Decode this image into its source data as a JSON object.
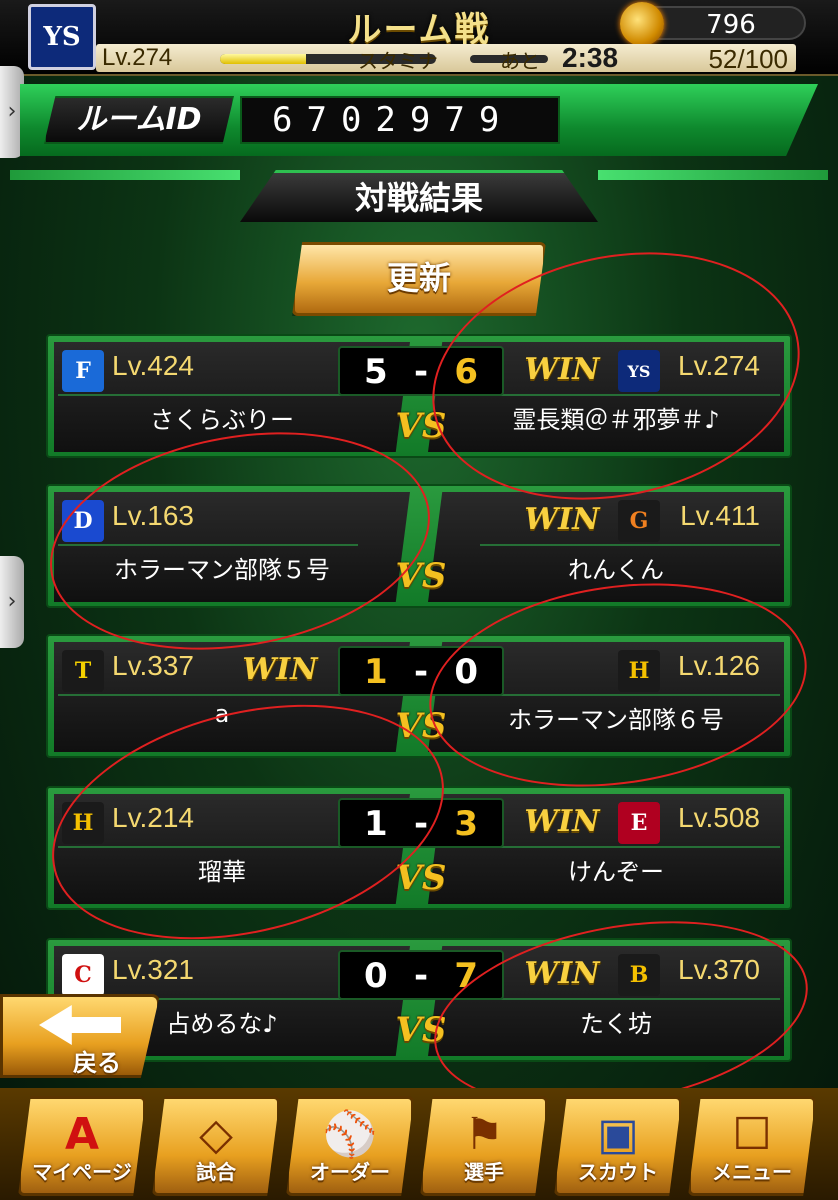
{
  "header": {
    "title": "ルーム戦",
    "team_logo": "YS",
    "coins": "796",
    "level": "Lv.274",
    "stamina_label": "スタミナ",
    "ato_label": "あと",
    "timer": "2:38",
    "stamina": "52/100"
  },
  "room": {
    "label": "ルームID",
    "id": "6702979"
  },
  "section_title": "対戦結果",
  "refresh_label": "更新",
  "matches": [
    {
      "left": {
        "logo": "F",
        "logo_color": "#1a6ad8",
        "level": "Lv.424",
        "name": "さくらぶりー"
      },
      "right": {
        "logo": "YS",
        "logo_color": "#0d2a7a",
        "level": "Lv.274",
        "name": "霊長類＠＃邪夢＃♪"
      },
      "score_left": "5",
      "score_dash": "-",
      "score_right": "6",
      "winner": "right"
    },
    {
      "left": {
        "logo": "D",
        "logo_color": "#1a4ad0",
        "level": "Lv.163",
        "name": "ホラーマン部隊５号"
      },
      "right": {
        "logo": "G",
        "logo_color": "#1a1a1a",
        "level": "Lv.411",
        "name": "れんくん"
      },
      "score_left": "",
      "score_dash": "",
      "score_right": "",
      "winner": "right"
    },
    {
      "left": {
        "logo": "T",
        "logo_color": "#1a1a1a",
        "level": "Lv.337",
        "name": "a"
      },
      "right": {
        "logo": "H",
        "logo_color": "#1a1a1a",
        "level": "Lv.126",
        "name": "ホラーマン部隊６号"
      },
      "score_left": "1",
      "score_dash": "-",
      "score_right": "0",
      "winner": "left"
    },
    {
      "left": {
        "logo": "H",
        "logo_color": "#1a1a1a",
        "level": "Lv.214",
        "name": "瑠華"
      },
      "right": {
        "logo": "E",
        "logo_color": "#b00020",
        "level": "Lv.508",
        "name": "けんぞー"
      },
      "score_left": "1",
      "score_dash": "-",
      "score_right": "3",
      "winner": "right"
    },
    {
      "left": {
        "logo": "C",
        "logo_color": "#d01010",
        "level": "Lv.321",
        "name": "占めるな♪"
      },
      "right": {
        "logo": "B",
        "logo_color": "#1a1a1a",
        "level": "Lv.370",
        "name": "たく坊"
      },
      "score_left": "0",
      "score_dash": "-",
      "score_right": "7",
      "winner": "right"
    }
  ],
  "win_label": "WIN",
  "vs_label": "VS",
  "back_label": "戻る",
  "nav": [
    {
      "label": "マイページ",
      "icon": "A"
    },
    {
      "label": "試合",
      "icon": "◇"
    },
    {
      "label": "オーダー",
      "icon": "⚾"
    },
    {
      "label": "選手",
      "icon": "⚑"
    },
    {
      "label": "スカウト",
      "icon": "▣"
    },
    {
      "label": "メニュー",
      "icon": "☐"
    }
  ],
  "colors": {
    "accent_green": "#2ec050",
    "gold": "#f4c020",
    "annotation_red": "#e02020"
  }
}
